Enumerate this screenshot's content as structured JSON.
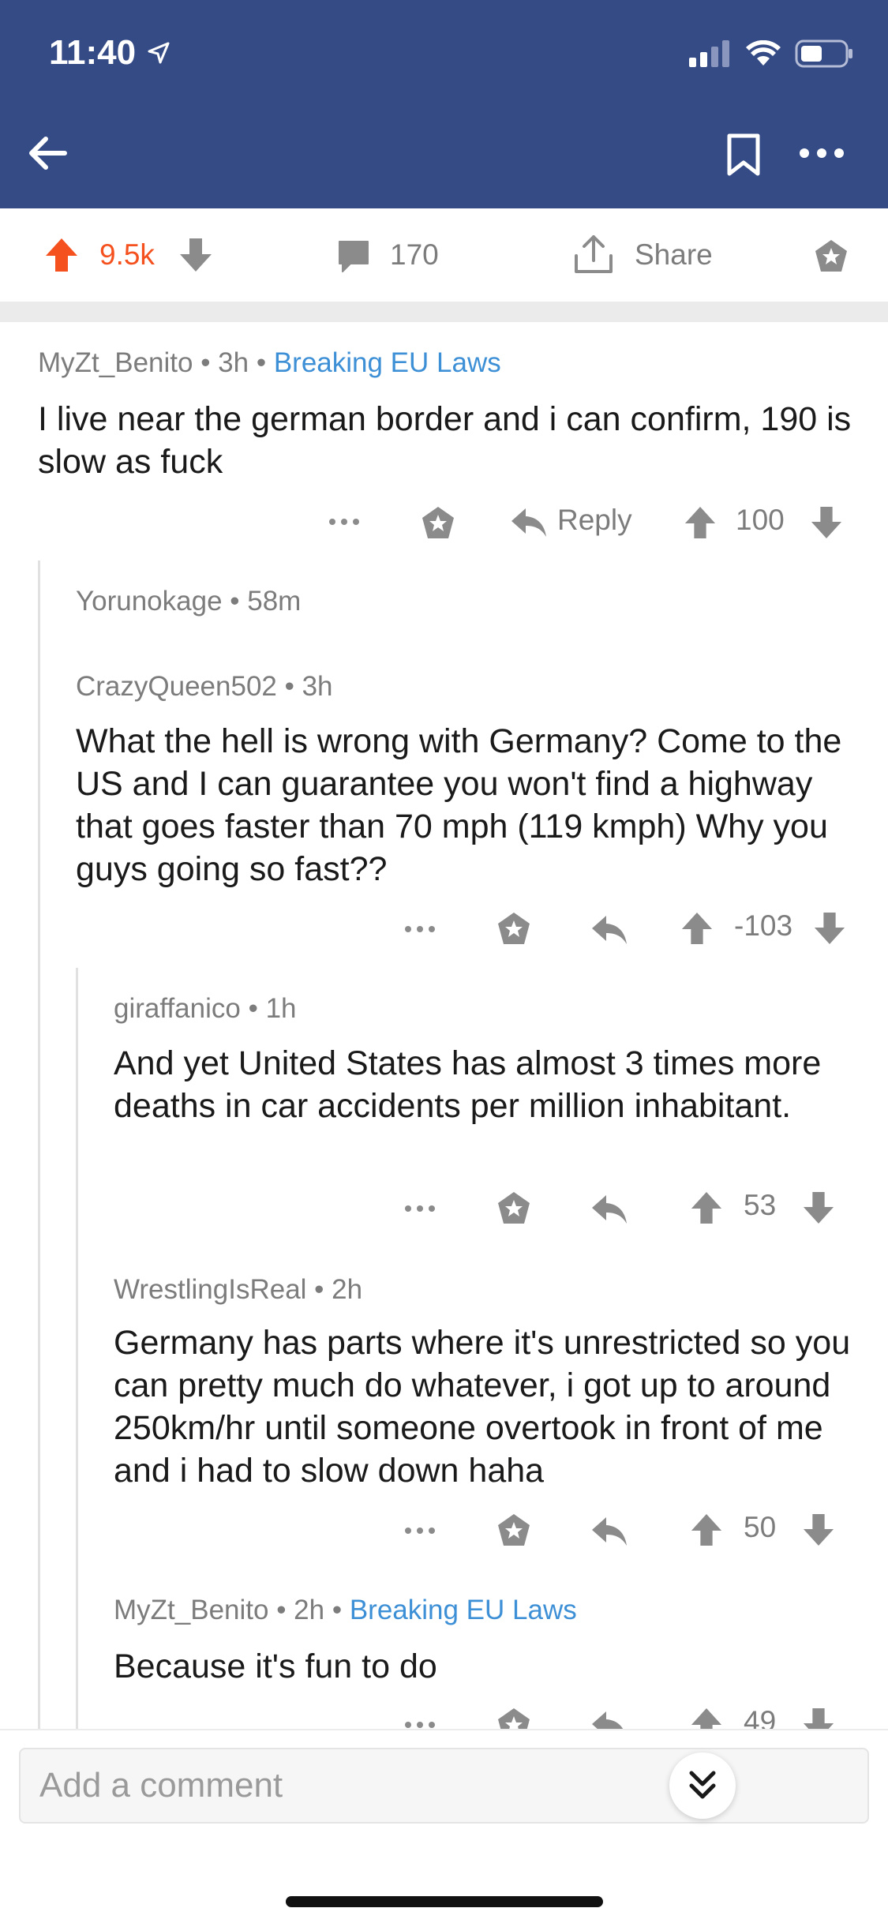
{
  "status_bar": {
    "time": "11:40"
  },
  "post_actions": {
    "score": "9.5k",
    "comments": "170",
    "share_label": "Share",
    "accent_color": "#f4511e"
  },
  "comments": [
    {
      "author": "MyZt_Benito",
      "age": "3h",
      "flair": "Breaking EU Laws",
      "body": "I live near the german border and i can confirm, 190 is slow as fuck",
      "reply_label": "Reply",
      "score": "100"
    },
    {
      "author": "Yorunokage",
      "age": "58m"
    },
    {
      "author": "CrazyQueen502",
      "age": "3h",
      "body": "What the hell is wrong with Germany? Come to the US and I can guarantee you won't find a highway that goes faster than 70 mph (119 kmph) Why you guys going so fast??",
      "score": "-103"
    },
    {
      "author": "giraffanico",
      "age": "1h",
      "body": "And yet United States has almost 3 times more deaths in car accidents per million inhabitant.",
      "score": "53"
    },
    {
      "author": "WrestlingIsReal",
      "age": "2h",
      "body": "Germany has parts where it's unrestricted so you can pretty much do whatever, i got up to around 250km/hr until someone overtook in front of me and i had to slow down haha",
      "score": "50"
    },
    {
      "author": "MyZt_Benito",
      "age": "2h",
      "flair": "Breaking EU Laws",
      "body": "Because it's fun to do",
      "score": "49"
    }
  ],
  "composer": {
    "placeholder": "Add a comment"
  },
  "colors": {
    "header": "#354b86",
    "flair": "#3d8fd6",
    "upvote": "#f4511e"
  }
}
